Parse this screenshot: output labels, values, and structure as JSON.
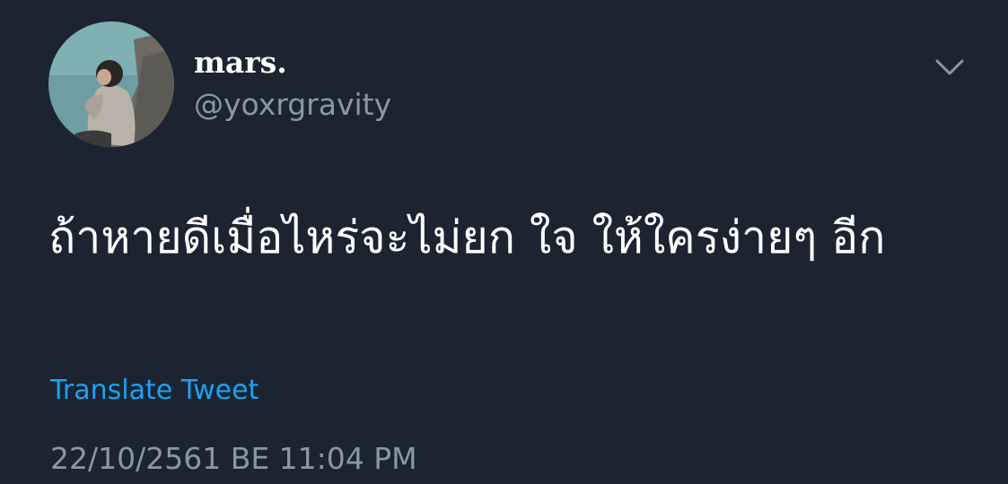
{
  "tweet": {
    "author": {
      "display_name": "mars.",
      "handle": "@yoxrgravity",
      "avatar_icon": "user-avatar-photo"
    },
    "menu_icon": "chevron-down-icon",
    "text": "ถ้าหายดีเมื่อไหร่จะไม่ยก ใจ ให้ใครง่ายๆ อีก",
    "translate_label": "Translate Tweet",
    "timestamp": "22/10/2561 BE 11:04 PM"
  },
  "colors": {
    "background": "#1b2430",
    "primary_text": "#ffffff",
    "secondary_text": "#8899a6",
    "link": "#1da1f2"
  }
}
